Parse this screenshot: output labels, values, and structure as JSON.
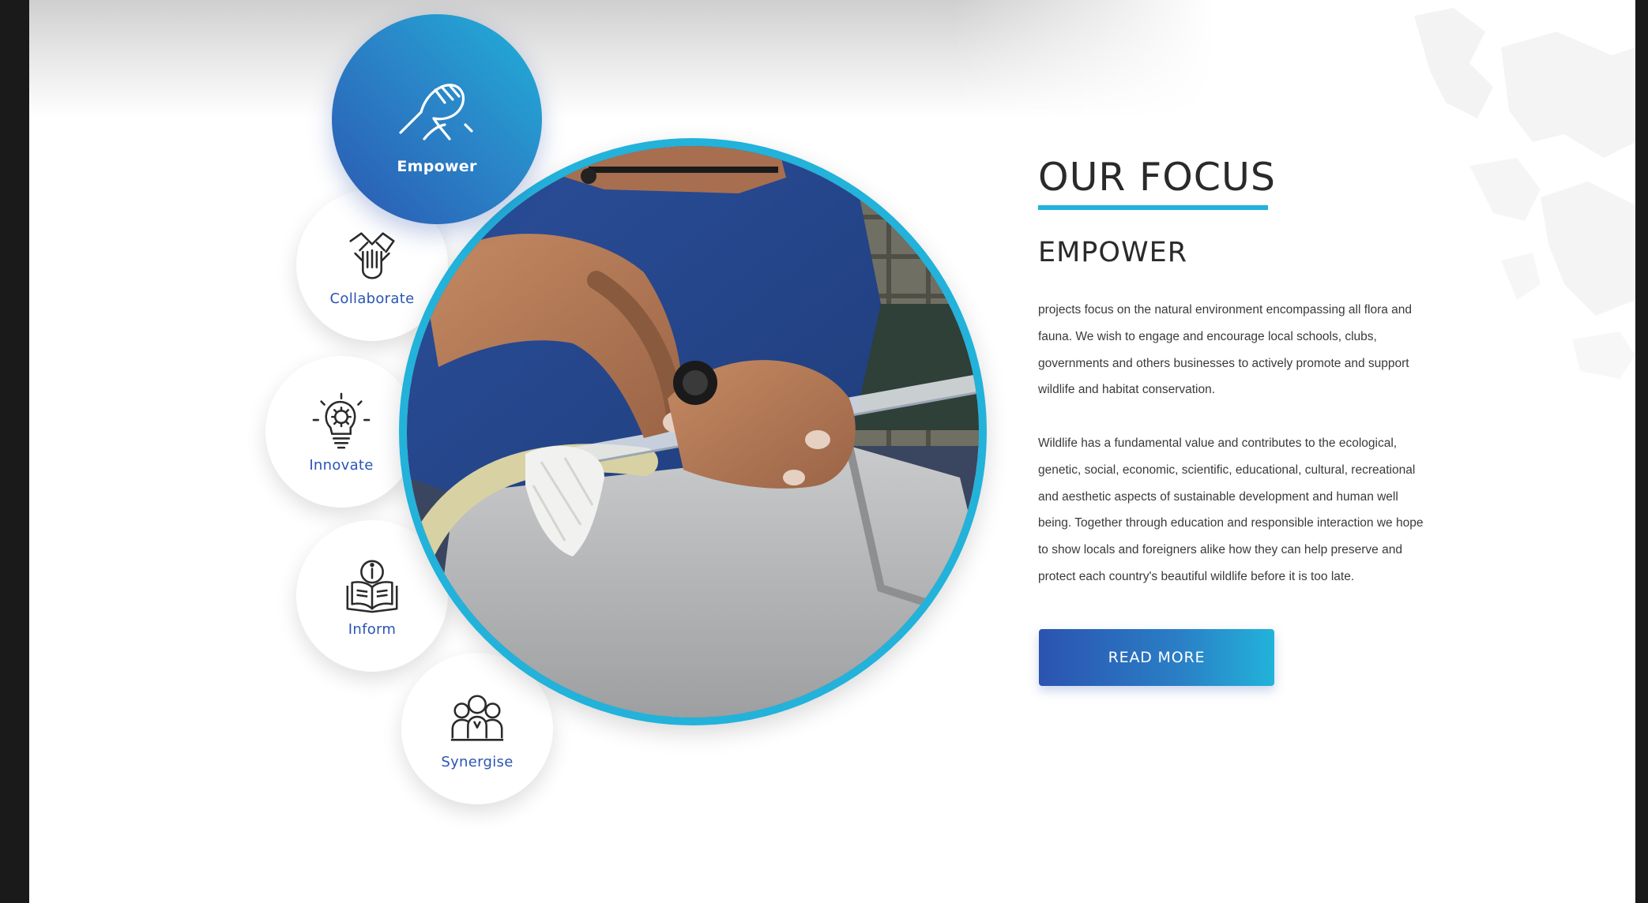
{
  "section": {
    "title": "OUR FOCUS",
    "subtitle": "EMPOWER",
    "paragraphs": [
      "projects focus on the natural environment encompassing all flora and fauna. We wish to engage and encourage local schools, clubs, governments and others businesses to actively promote and support wildlife and habitat conservation.",
      "Wildlife has a fundamental value and contributes to the ecological, genetic, social, economic, scientific, educational, cultural, recreational and aesthetic aspects of sustainable development and human well being. Together through education and responsible interaction we hope to show locals and foreigners alike how they can help preserve and protect each country's beautiful wildlife before it is too late."
    ],
    "button_label": "READ MORE"
  },
  "focus_items": [
    {
      "label": "Empower",
      "icon": "arm-wrestle-icon",
      "active": true
    },
    {
      "label": "Collaborate",
      "icon": "stacked-hands-icon",
      "active": false
    },
    {
      "label": "Innovate",
      "icon": "lightbulb-gear-icon",
      "active": false
    },
    {
      "label": "Inform",
      "icon": "book-info-icon",
      "active": false
    },
    {
      "label": "Synergise",
      "icon": "team-group-icon",
      "active": false
    }
  ],
  "colors": {
    "accent": "#22b2da",
    "primary": "#2b53b0",
    "label": "#2a55b3",
    "text": "#2a2a2a"
  }
}
